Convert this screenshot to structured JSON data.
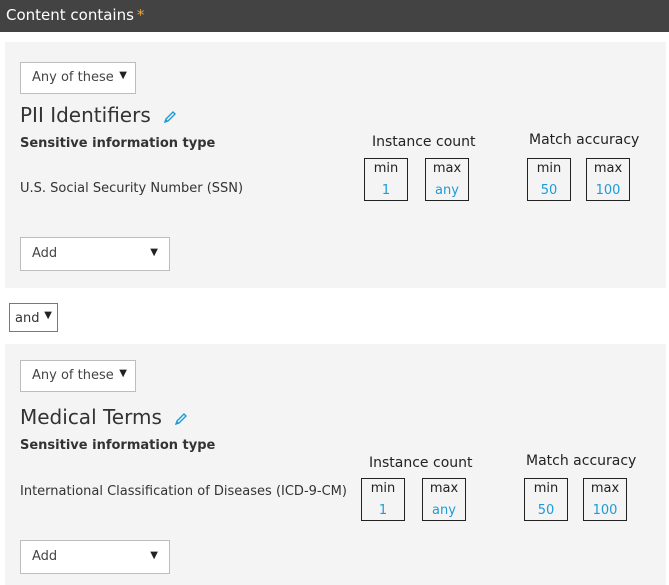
{
  "header": {
    "title": "Content contains",
    "required_mark": "*"
  },
  "groups": [
    {
      "match_mode": "Any of these",
      "name": "PII Identifiers",
      "column_header": "Sensitive information type",
      "type_name": "U.S. Social Security Number (SSN)",
      "instance_count_label": "Instance count",
      "match_accuracy_label": "Match accuracy",
      "min_label": "min",
      "max_label": "max",
      "instance_min": "1",
      "instance_max": "any",
      "accuracy_min": "50",
      "accuracy_max": "100",
      "add_label": "Add"
    },
    {
      "match_mode": "Any of these",
      "name": "Medical Terms",
      "column_header": "Sensitive information type",
      "type_name": "International Classification of Diseases (ICD-9-CM)",
      "instance_count_label": "Instance count",
      "match_accuracy_label": "Match accuracy",
      "min_label": "min",
      "max_label": "max",
      "instance_min": "1",
      "instance_max": "any",
      "accuracy_min": "50",
      "accuracy_max": "100",
      "add_label": "Add"
    }
  ],
  "operator": {
    "value": "and"
  },
  "icons": {
    "edit": "pencil-icon",
    "dropdown": "caret-down-icon"
  },
  "colors": {
    "header_bg": "#434343",
    "accent": "#1e9bd7",
    "required": "#f5a623"
  }
}
